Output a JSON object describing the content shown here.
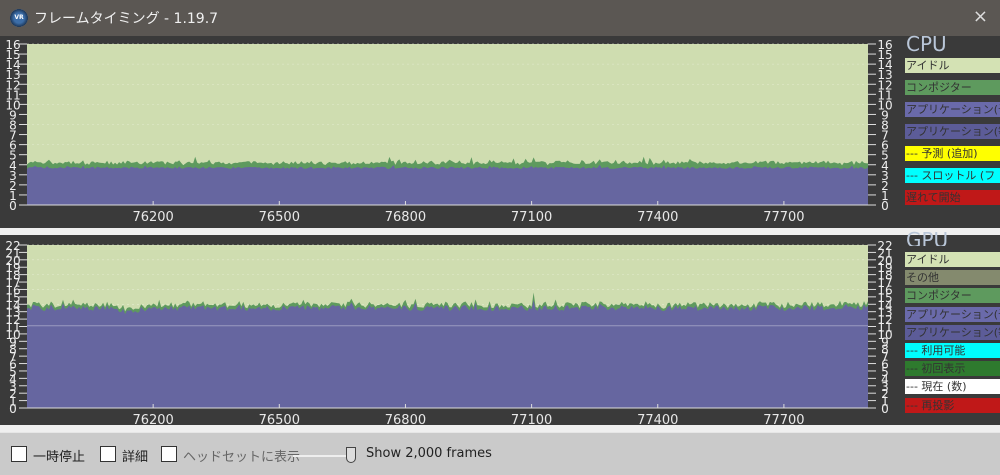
{
  "window": {
    "title": "フレームタイミング - 1.19.7",
    "icon": "vr-icon",
    "close": "×"
  },
  "colors": {
    "idle": "#cfddb0",
    "compositor": "#5e9a5e",
    "app": "#6666a0",
    "app2": "#5c5c98",
    "other": "#848a6e"
  },
  "cpu": {
    "label": "CPU",
    "legend": [
      {
        "label": "アイドル",
        "bg": "#d4e2b4"
      },
      {
        "label": "コンポジター",
        "bg": "#5e9a5e"
      },
      {
        "label": "アプリケーション(予",
        "bg": "#6a6aaa"
      },
      {
        "label": "アプリケーション(等",
        "bg": "#5c5c98"
      },
      {
        "label": "--- 予測 (追加)",
        "bg": "#ffff00"
      },
      {
        "label": "--- スロットル (フ",
        "bg": "#00ffff"
      },
      {
        "label": "遅れて開始",
        "bg": "#c01818"
      }
    ]
  },
  "gpu": {
    "label": "GPU",
    "legend": [
      {
        "label": "アイドル",
        "bg": "#d4e2b4"
      },
      {
        "label": "その他",
        "bg": "#848a6e"
      },
      {
        "label": "コンポジター",
        "bg": "#5e9a5e"
      },
      {
        "label": "アプリケーション(予",
        "bg": "#6a6aaa"
      },
      {
        "label": "アプリケーション(等",
        "bg": "#5c5c98"
      },
      {
        "label": "--- 利用可能",
        "bg": "#00ffff"
      },
      {
        "label": "--- 初回表示",
        "bg": "#2e7a2e"
      },
      {
        "label": "--- 現在 (数)",
        "bg": "#ffffff"
      },
      {
        "label": "--- 再投影",
        "bg": "#c01818"
      }
    ]
  },
  "chart_data": [
    {
      "type": "area",
      "title": "CPU",
      "xlim": [
        75900,
        77900
      ],
      "ylim": [
        0,
        16
      ],
      "xticks": [
        76200,
        76500,
        76800,
        77100,
        77400,
        77700
      ],
      "yticks": [
        0,
        1,
        2,
        3,
        4,
        5,
        6,
        7,
        8,
        9,
        10,
        11,
        12,
        13,
        14,
        15,
        16
      ],
      "series": [
        {
          "name": "アプリケーション",
          "mean": 3.7
        },
        {
          "name": "コンポジター",
          "mean": 0.35
        },
        {
          "name": "アイドル",
          "mean": 11.9
        }
      ]
    },
    {
      "type": "area",
      "title": "GPU",
      "xlim": [
        75900,
        77900
      ],
      "ylim": [
        0,
        22
      ],
      "xticks": [
        76200,
        76500,
        76800,
        77100,
        77400,
        77700
      ],
      "yticks": [
        0,
        1,
        2,
        3,
        4,
        5,
        6,
        7,
        8,
        9,
        10,
        11,
        12,
        13,
        14,
        15,
        16,
        17,
        18,
        19,
        20,
        21,
        22
      ],
      "reference_line": 11.1,
      "series": [
        {
          "name": "アプリケーション",
          "mean": 13.5
        },
        {
          "name": "コンポジター",
          "mean": 0.3
        },
        {
          "name": "アイドル",
          "mean": 8.2
        }
      ]
    }
  ],
  "controls": {
    "pause": "一時停止",
    "details": "詳細",
    "show_in_headset": "ヘッドセットに表示",
    "frames": "Show 2,000 frames",
    "slider_fraction": 0.9
  }
}
